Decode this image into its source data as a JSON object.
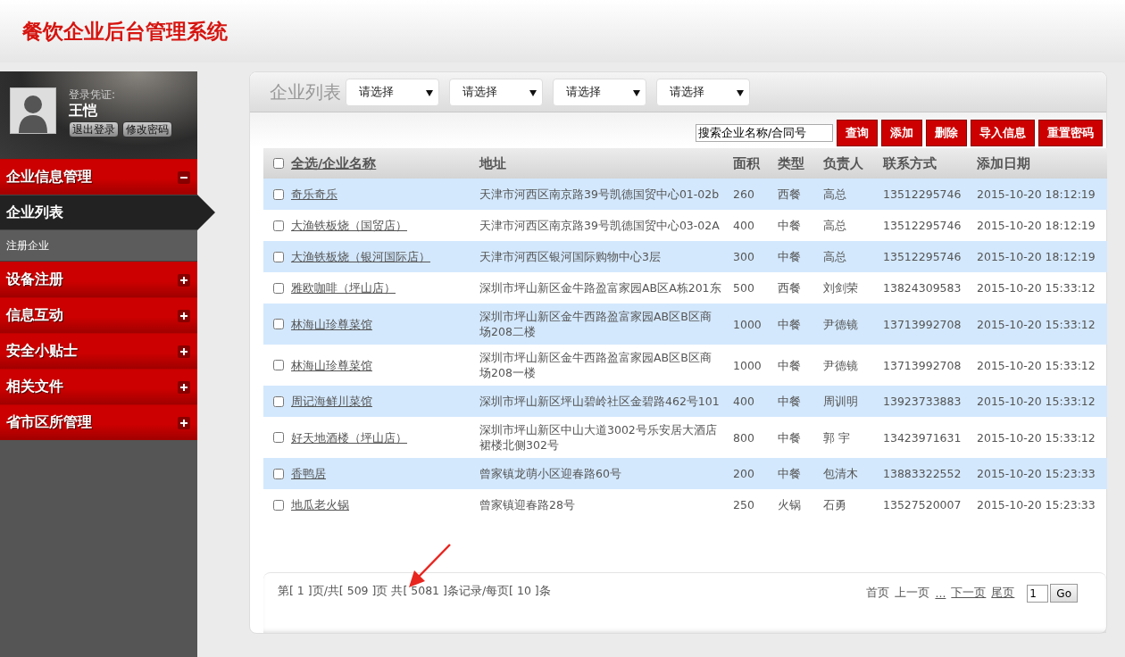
{
  "app": {
    "title": "餐饮企业后台管理系统"
  },
  "user": {
    "label": "登录凭证:",
    "name": "王恺",
    "buttons": [
      "退出登录",
      "修改密码"
    ]
  },
  "sidebar": {
    "items": [
      {
        "label": "企业信息管理",
        "expanded": true,
        "children": [
          {
            "label": "企业列表",
            "selected": true
          },
          {
            "label": "注册企业",
            "selected": false
          }
        ]
      },
      {
        "label": "设备注册",
        "expanded": false
      },
      {
        "label": "信息互动",
        "expanded": false
      },
      {
        "label": "安全小贴士",
        "expanded": false
      },
      {
        "label": "相关文件",
        "expanded": false
      },
      {
        "label": "省市区所管理",
        "expanded": false
      }
    ]
  },
  "panel": {
    "title": "企业列表",
    "filters": [
      "请选择",
      "请选择",
      "请选择",
      "请选择"
    ],
    "search": {
      "value": "搜索企业名称/合同号"
    },
    "buttons": [
      "查询",
      "添加",
      "删除",
      "导入信息",
      "重置密码"
    ],
    "table": {
      "select_all_checked": false,
      "columns": [
        "全选/企业名称",
        "地址",
        "面积",
        "类型",
        "负责人",
        "联系方式",
        "添加日期"
      ],
      "rows": [
        {
          "checked": false,
          "cells": [
            "奇乐奇乐",
            "天津市河西区南京路39号凯德国贸中心01-02b",
            "260",
            "西餐",
            "高总",
            "13512295746",
            "2015-10-20 18:12:19"
          ]
        },
        {
          "checked": false,
          "cells": [
            "大渔铁板烧（国贸店）",
            "天津市河西区南京路39号凯德国贸中心03-02A",
            "400",
            "中餐",
            "高总",
            "13512295746",
            "2015-10-20 18:12:19"
          ]
        },
        {
          "checked": false,
          "cells": [
            "大渔铁板烧（银河国际店）",
            "天津市河西区银河国际购物中心3层",
            "300",
            "中餐",
            "高总",
            "13512295746",
            "2015-10-20 18:12:19"
          ]
        },
        {
          "checked": false,
          "cells": [
            "雅欧咖啡（坪山店）",
            "深圳市坪山新区金牛路盈富家园AB区A栋201东",
            "500",
            "西餐",
            "刘剑荣",
            "13824309583",
            "2015-10-20 15:33:12"
          ]
        },
        {
          "checked": false,
          "cells": [
            "林海山珍尊菜馆",
            "深圳市坪山新区金牛西路盈富家园AB区B区商场208二楼",
            "1000",
            "中餐",
            "尹德镜",
            "13713992708",
            "2015-10-20 15:33:12"
          ]
        },
        {
          "checked": false,
          "cells": [
            "林海山珍尊菜馆",
            "深圳市坪山新区金牛西路盈富家园AB区B区商场208一楼",
            "1000",
            "中餐",
            "尹德镜",
            "13713992708",
            "2015-10-20 15:33:12"
          ]
        },
        {
          "checked": false,
          "cells": [
            "周记海鲜川菜馆",
            "深圳市坪山新区坪山碧岭社区金碧路462号101",
            "400",
            "中餐",
            "周训明",
            "13923733883",
            "2015-10-20 15:33:12"
          ]
        },
        {
          "checked": false,
          "cells": [
            "好天地酒楼（坪山店）",
            "深圳市坪山新区中山大道3002号乐安居大酒店裙楼北侧302号",
            "800",
            "中餐",
            "郭 宇",
            "13423971631",
            "2015-10-20 15:33:12"
          ]
        },
        {
          "checked": false,
          "cells": [
            "香鸭居",
            "曾家镇龙萌小区迎春路60号",
            "200",
            "中餐",
            "包清木",
            "13883322552",
            "2015-10-20 15:23:33"
          ]
        },
        {
          "checked": false,
          "cells": [
            "地瓜老火锅",
            "曾家镇迎春路28号",
            "250",
            "火锅",
            "石勇",
            "13527520007",
            "2015-10-20 15:23:33"
          ]
        }
      ]
    },
    "pager": {
      "summary": "第[ 1 ]页/共[ 509 ]页 共[ 5081 ]条记录/每页[ 10 ]条",
      "links": [
        {
          "label": "首页",
          "disabled": true
        },
        {
          "label": "上一页",
          "disabled": true
        },
        {
          "label": "...",
          "disabled": false
        },
        {
          "label": "下一页",
          "disabled": false
        },
        {
          "label": "尾页",
          "disabled": false
        }
      ],
      "page_input": {
        "value": "1"
      },
      "go": "Go"
    }
  }
}
